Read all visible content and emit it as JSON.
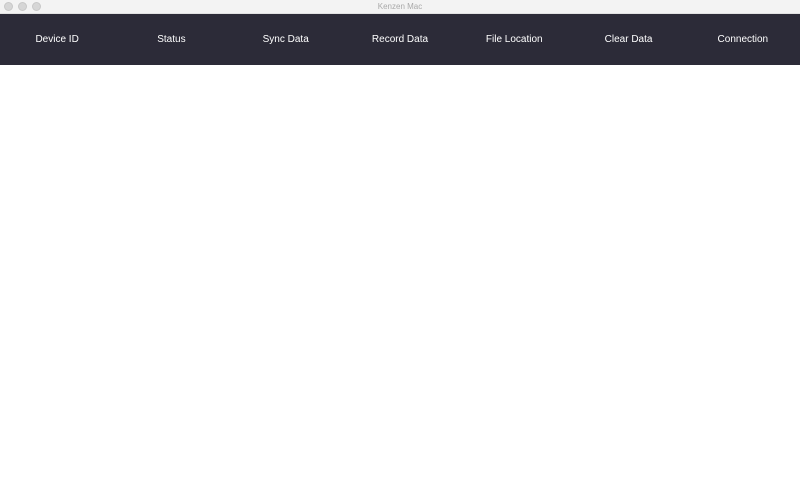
{
  "window": {
    "title": "Kenzen Mac"
  },
  "header": {
    "columns": [
      {
        "label": "Device ID"
      },
      {
        "label": "Status"
      },
      {
        "label": "Sync Data"
      },
      {
        "label": "Record Data"
      },
      {
        "label": "File Location"
      },
      {
        "label": "Clear Data"
      },
      {
        "label": "Connection"
      }
    ]
  },
  "colors": {
    "header_background": "#2c2b38",
    "header_text": "#ffffff",
    "content_background": "#ffffff"
  }
}
